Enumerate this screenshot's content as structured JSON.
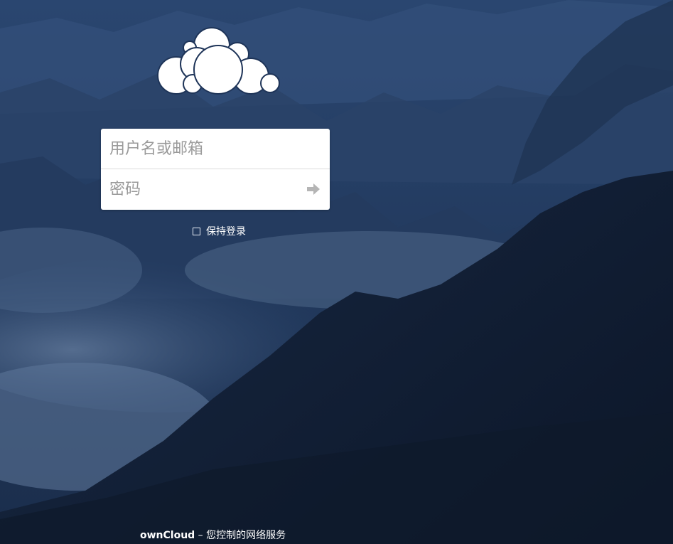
{
  "app": {
    "logo_icon": "owncloud-cloud-logo-icon"
  },
  "login": {
    "username_placeholder": "用户名或邮箱",
    "password_placeholder": "密码",
    "submit_icon": "arrow-right-icon",
    "remember_label": "保持登录",
    "remember_checked": false
  },
  "footer": {
    "brand": "ownCloud",
    "separator": " – ",
    "tagline": "您控制的网络服务"
  },
  "colors": {
    "background": "#1c3357",
    "mountain_dark": "#0f1b2f",
    "cloud_light": "#6f86a8",
    "input_placeholder": "#9a9a9a",
    "submit_arrow": "#b5b5b5"
  }
}
